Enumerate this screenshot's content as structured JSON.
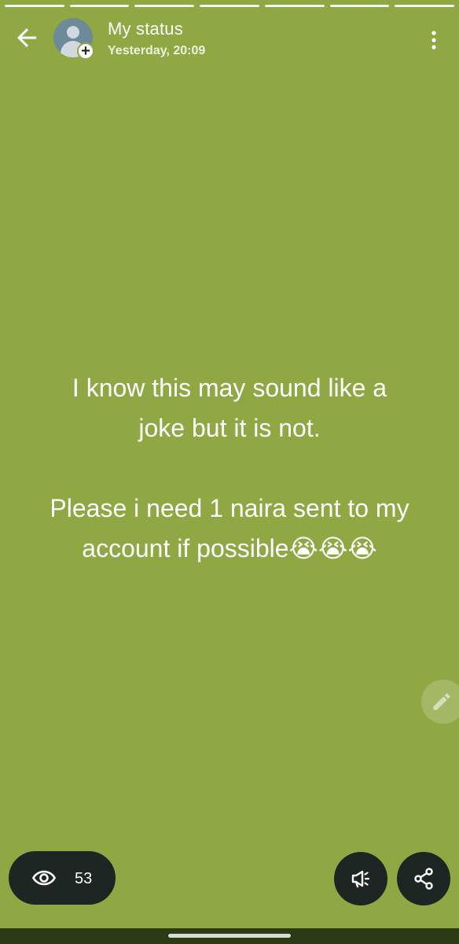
{
  "header": {
    "title": "My status",
    "timestamp": "Yesterday, 20:09"
  },
  "status": {
    "text": "I know this may sound like a\njoke but it is not.\n\nPlease i need 1 naira sent to my\naccount if possible😭😭😭",
    "background_color": "#8fa843",
    "segment_count": 7
  },
  "footer": {
    "views_count": "53"
  },
  "icons": {
    "back": "arrow-left-icon",
    "avatar": "profile-avatar-icon",
    "add": "plus-icon",
    "menu": "more-vertical-icon",
    "edit": "pencil-icon",
    "views": "eye-icon",
    "promote": "megaphone-icon",
    "share": "share-icon"
  }
}
